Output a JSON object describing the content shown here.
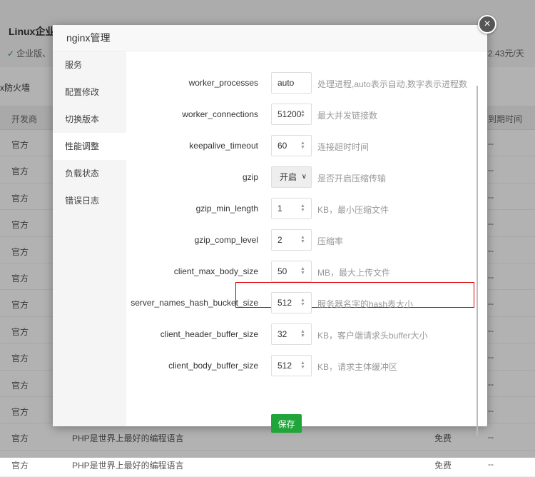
{
  "background": {
    "title": "Linux企业",
    "subtitle": "企业版、",
    "price": "2.43元/天",
    "firewall_label": "x防火墙",
    "table_headers": [
      "开发商",
      "到期时间"
    ],
    "rows": [
      {
        "dev": "官方",
        "desc": "",
        "price": "",
        "expire": "--"
      },
      {
        "dev": "官方",
        "desc": "",
        "price": "",
        "expire": "--"
      },
      {
        "dev": "官方",
        "desc": "",
        "price": "",
        "expire": "--"
      },
      {
        "dev": "官方",
        "desc": "",
        "price": "",
        "expire": "--"
      },
      {
        "dev": "官方",
        "desc": "",
        "price": "",
        "expire": "--"
      },
      {
        "dev": "官方",
        "desc": "",
        "price": "",
        "expire": "--"
      },
      {
        "dev": "官方",
        "desc": "",
        "price": "",
        "expire": "--"
      },
      {
        "dev": "官方",
        "desc": "",
        "price": "",
        "expire": "--"
      },
      {
        "dev": "官方",
        "desc": "",
        "price": "",
        "expire": "--"
      },
      {
        "dev": "官方",
        "desc": "",
        "price": "",
        "expire": "--"
      },
      {
        "dev": "官方",
        "desc": "",
        "price": "",
        "expire": "--"
      },
      {
        "dev": "官方",
        "desc": "PHP是世界上最好的编程语言",
        "price": "免费",
        "expire": "--"
      },
      {
        "dev": "官方",
        "desc": "PHP是世界上最好的编程语言",
        "price": "免费",
        "expire": "--"
      }
    ]
  },
  "modal": {
    "title": "nginx管理",
    "close_icon": "×",
    "menu": [
      {
        "label": "服务",
        "active": false
      },
      {
        "label": "配置修改",
        "active": false
      },
      {
        "label": "切换版本",
        "active": false
      },
      {
        "label": "性能调整",
        "active": true
      },
      {
        "label": "负载状态",
        "active": false
      },
      {
        "label": "错误日志",
        "active": false
      }
    ],
    "fields": [
      {
        "label": "worker_processes",
        "value": "auto",
        "type": "text",
        "hint": "处理进程,auto表示自动,数字表示进程数"
      },
      {
        "label": "worker_connections",
        "value": "51200",
        "type": "number",
        "hint": "最大并发链接数"
      },
      {
        "label": "keepalive_timeout",
        "value": "60",
        "type": "number",
        "hint": "连接超时时间"
      },
      {
        "label": "gzip",
        "value": "开启",
        "type": "select",
        "hint": "是否开启压缩传输"
      },
      {
        "label": "gzip_min_length",
        "value": "1",
        "type": "number",
        "hint": "KB，最小压缩文件"
      },
      {
        "label": "gzip_comp_level",
        "value": "2",
        "type": "number",
        "hint": "压缩率"
      },
      {
        "label": "client_max_body_size",
        "value": "50",
        "type": "number",
        "hint": "MB，最大上传文件",
        "highlighted": true
      },
      {
        "label": "server_names_hash_bucket_size",
        "value": "512",
        "type": "number",
        "hint": "服务器名字的hash表大小"
      },
      {
        "label": "client_header_buffer_size",
        "value": "32",
        "type": "number",
        "hint": "KB，客户端请求头buffer大小"
      },
      {
        "label": "client_body_buffer_size",
        "value": "512",
        "type": "number",
        "hint": "KB，请求主体缓冲区"
      }
    ],
    "save_label": "保存",
    "accent_color": "#20a53a",
    "highlight_color": "#e0000a"
  }
}
